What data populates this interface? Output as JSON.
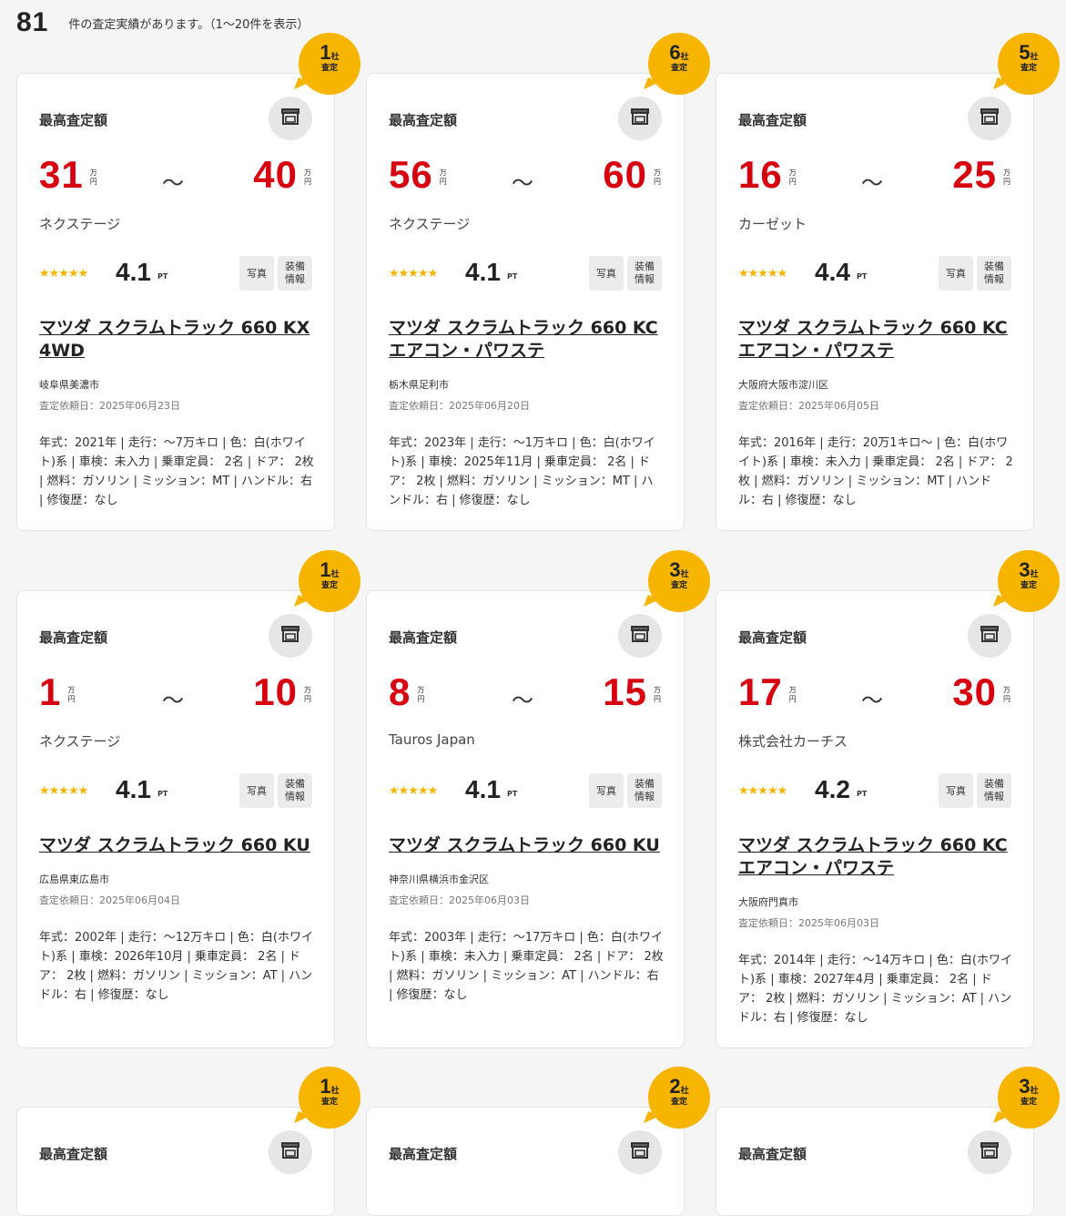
{
  "summary": {
    "count": "81",
    "text": "件の査定実績があります。（1〜20件を表示）"
  },
  "labels": {
    "max_price": "最高査定額",
    "man_yen": "万円",
    "tilde": "〜",
    "pt": "PT",
    "photo": "写真",
    "equipment": "装備情報",
    "company_unit": "社",
    "assessment": "査定",
    "stars": "★★★★★"
  },
  "cards": [
    {
      "companies": "1",
      "price_low": "31",
      "price_high": "40",
      "shop": "ネクステージ",
      "rating": "4.1",
      "title": "マツダ スクラムトラック 660 KX 4WD",
      "location": "岐阜県美濃市",
      "request_date": "査定依頼日：2025年06月23日",
      "specs": "年式：2021年 | 走行：〜7万キロ | 色：白(ホワイト)系 | 車検：未入力 | 乗車定員： 2名 | ドア： 2枚 | 燃料：ガソリン | ミッション：MT | ハンドル：右 | 修復歴：なし"
    },
    {
      "companies": "6",
      "price_low": "56",
      "price_high": "60",
      "shop": "ネクステージ",
      "rating": "4.1",
      "title": "マツダ スクラムトラック 660 KC エアコン・パワステ",
      "location": "栃木県足利市",
      "request_date": "査定依頼日：2025年06月20日",
      "specs": "年式：2023年 | 走行：〜1万キロ | 色：白(ホワイト)系 | 車検：2025年11月 | 乗車定員： 2名 | ドア： 2枚 | 燃料：ガソリン | ミッション：MT | ハンドル：右 | 修復歴：なし"
    },
    {
      "companies": "5",
      "price_low": "16",
      "price_high": "25",
      "shop": "カーゼット",
      "rating": "4.4",
      "title": "マツダ スクラムトラック 660 KC エアコン・パワステ",
      "location": "大阪府大阪市淀川区",
      "request_date": "査定依頼日：2025年06月05日",
      "specs": "年式：2016年 | 走行：20万1キロ〜 | 色：白(ホワイト)系 | 車検：未入力 | 乗車定員： 2名 | ドア： 2枚 | 燃料：ガソリン | ミッション：MT | ハンドル：右 | 修復歴：なし"
    },
    {
      "companies": "1",
      "price_low": "1",
      "price_high": "10",
      "shop": "ネクステージ",
      "rating": "4.1",
      "title": "マツダ スクラムトラック 660 KU",
      "location": "広島県東広島市",
      "request_date": "査定依頼日：2025年06月04日",
      "specs": "年式：2002年 | 走行：〜12万キロ | 色：白(ホワイト)系 | 車検：2026年10月 | 乗車定員： 2名 | ドア： 2枚 | 燃料：ガソリン | ミッション：AT | ハンドル：右 | 修復歴：なし"
    },
    {
      "companies": "3",
      "price_low": "8",
      "price_high": "15",
      "shop": "Tauros Japan",
      "rating": "4.1",
      "title": "マツダ スクラムトラック 660 KU",
      "location": "神奈川県横浜市金沢区",
      "request_date": "査定依頼日：2025年06月03日",
      "specs": "年式：2003年 | 走行：〜17万キロ | 色：白(ホワイト)系 | 車検：未入力 | 乗車定員： 2名 | ドア： 2枚 | 燃料：ガソリン | ミッション：AT | ハンドル：右 | 修復歴：なし"
    },
    {
      "companies": "3",
      "price_low": "17",
      "price_high": "30",
      "shop": "株式会社カーチス",
      "rating": "4.2",
      "title": "マツダ スクラムトラック 660 KC エアコン・パワステ",
      "location": "大阪府門真市",
      "request_date": "査定依頼日：2025年06月03日",
      "specs": "年式：2014年 | 走行：〜14万キロ | 色：白(ホワイト)系 | 車検：2027年4月 | 乗車定員： 2名 | ドア： 2枚 | 燃料：ガソリン | ミッション：AT | ハンドル：右 | 修復歴：なし"
    },
    {
      "companies": "1"
    },
    {
      "companies": "2"
    },
    {
      "companies": "3"
    }
  ]
}
